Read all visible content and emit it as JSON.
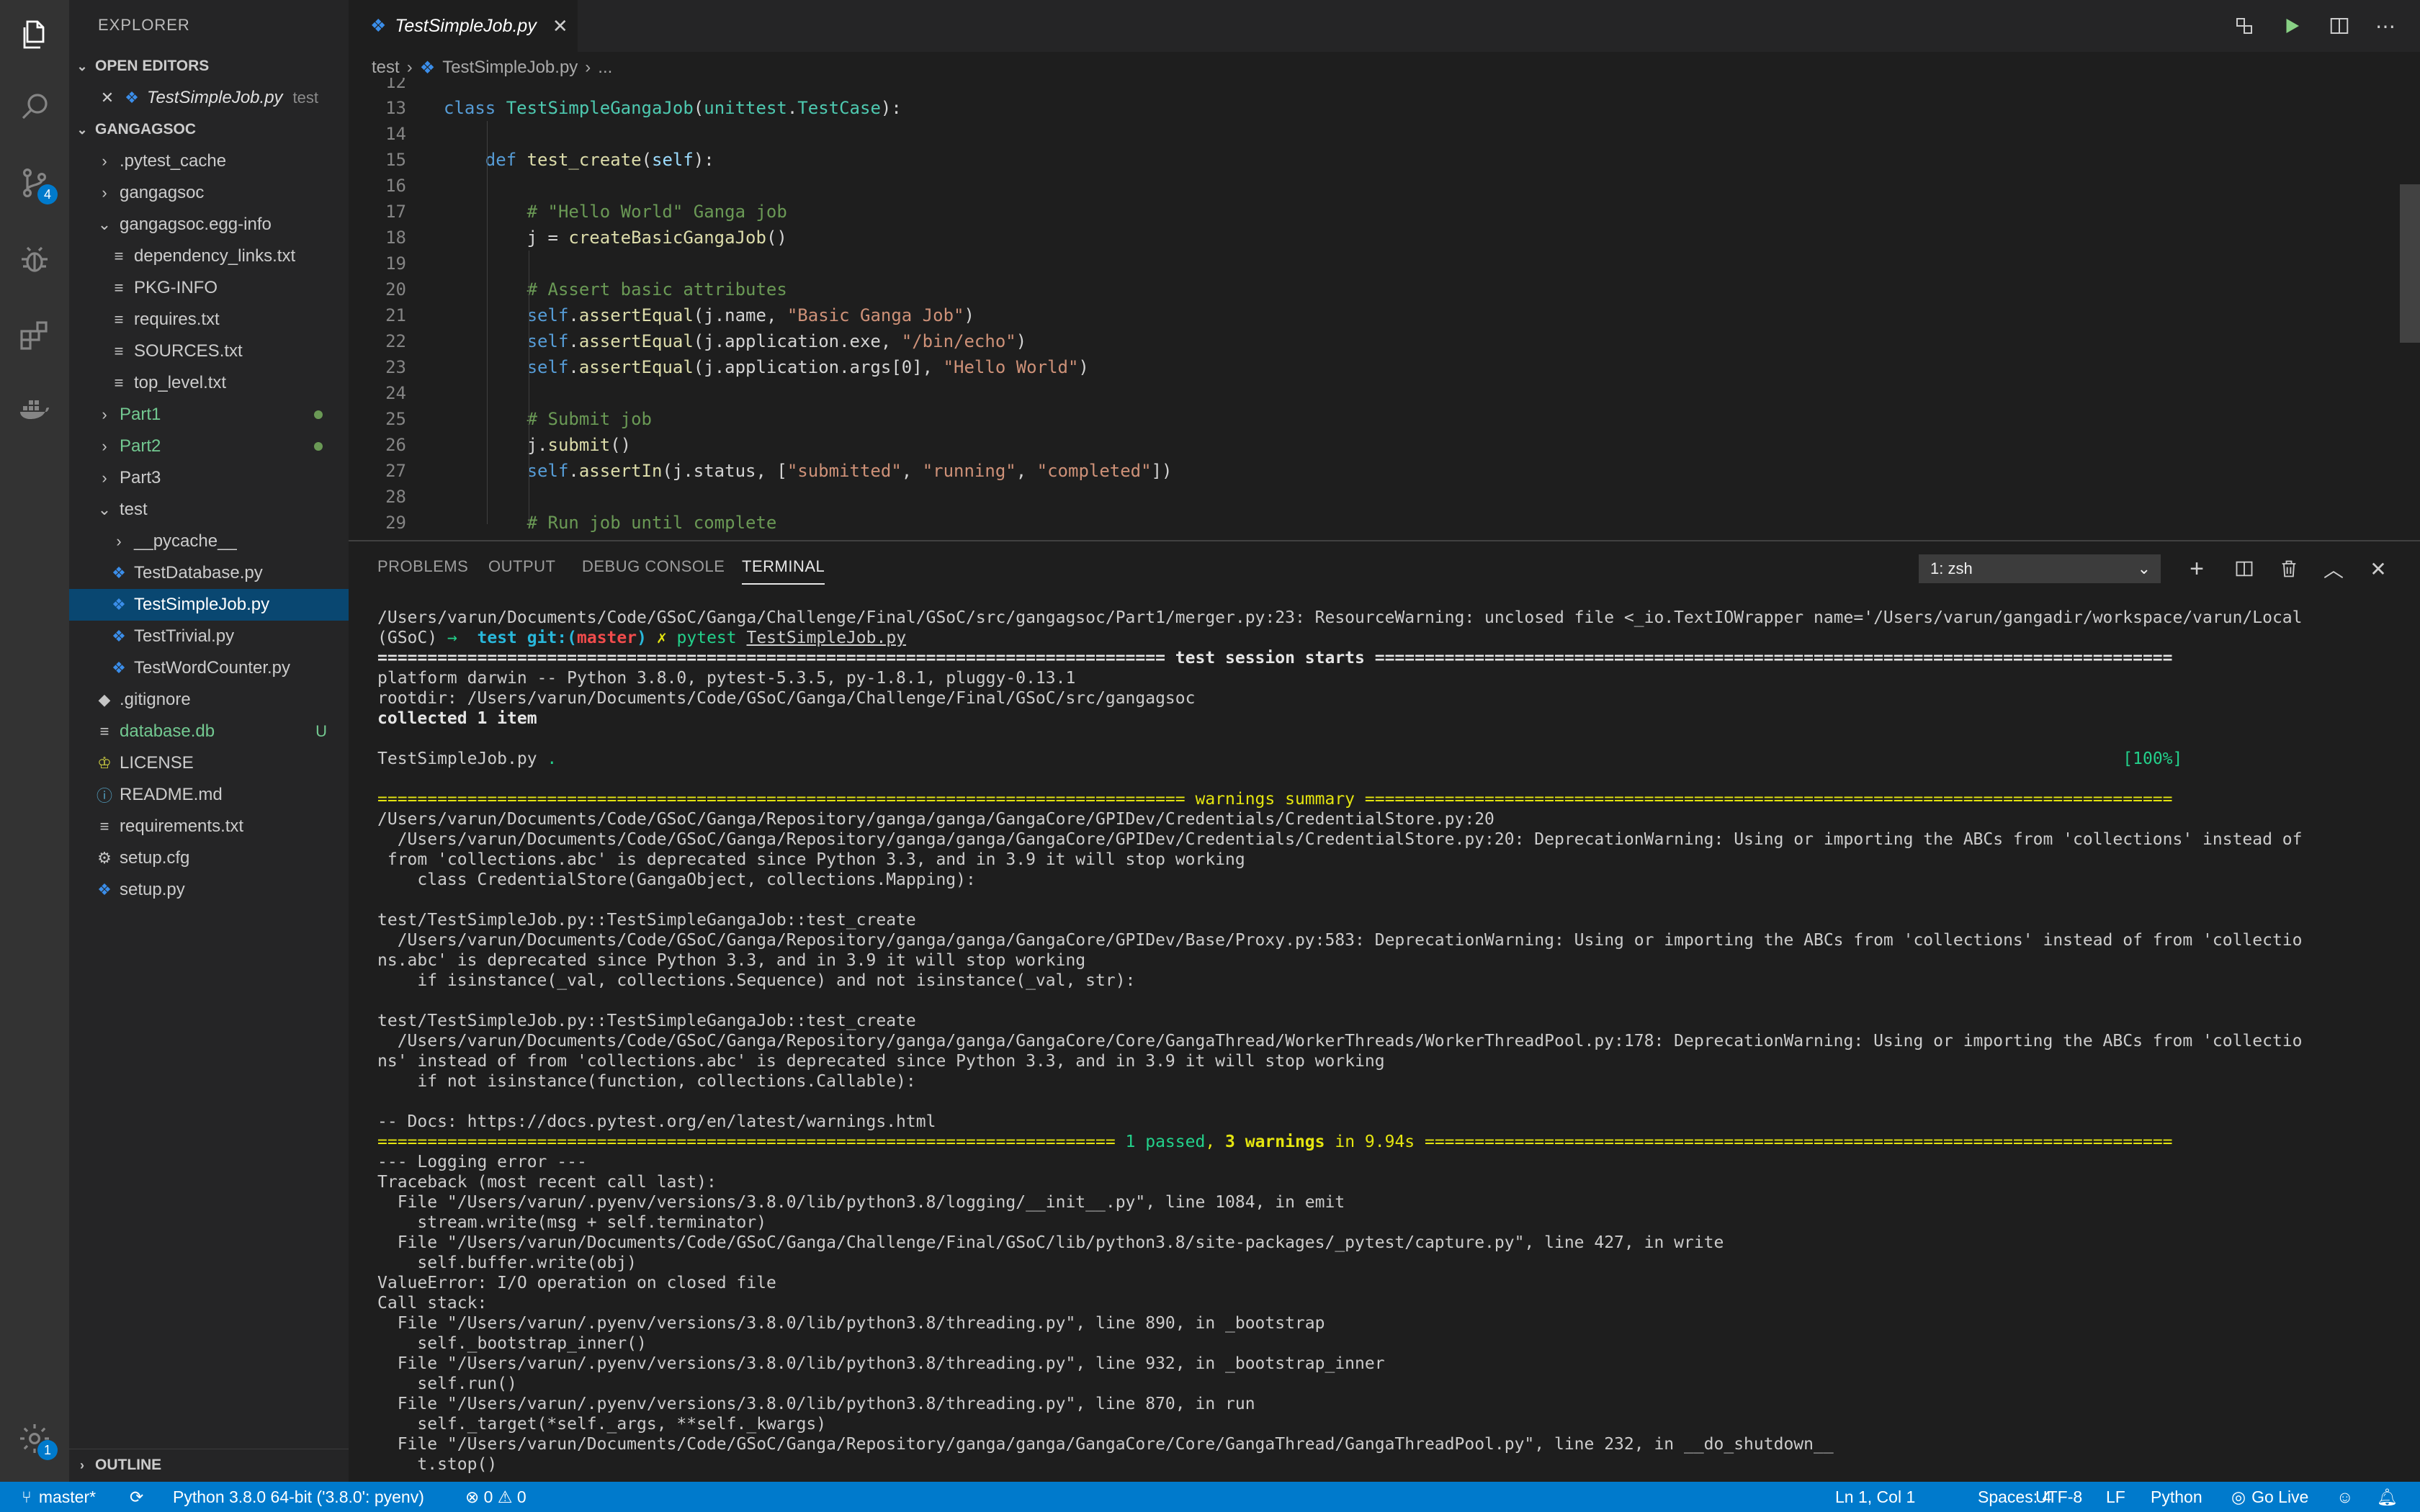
{
  "sidebar": {
    "title": "EXPLORER",
    "open_editors_label": "OPEN EDITORS",
    "open_editor": {
      "name": "TestSimpleJob.py",
      "folder": "test"
    },
    "project_label": "GANGAGSOC",
    "outline_label": "OUTLINE",
    "tree": [
      {
        "label": ".pytest_cache",
        "type": "folder-closed",
        "indent": 1,
        "color": "#cccccc"
      },
      {
        "label": "gangagsoc",
        "type": "folder-closed",
        "indent": 1,
        "color": "#cccccc"
      },
      {
        "label": "gangagsoc.egg-info",
        "type": "folder-open",
        "indent": 1,
        "color": "#cccccc"
      },
      {
        "label": "dependency_links.txt",
        "type": "file",
        "indent": 2,
        "color": "#cccccc"
      },
      {
        "label": "PKG-INFO",
        "type": "file",
        "indent": 2,
        "color": "#cccccc"
      },
      {
        "label": "requires.txt",
        "type": "file",
        "indent": 2,
        "color": "#cccccc"
      },
      {
        "label": "SOURCES.txt",
        "type": "file",
        "indent": 2,
        "color": "#cccccc"
      },
      {
        "label": "top_level.txt",
        "type": "file",
        "indent": 2,
        "color": "#cccccc"
      },
      {
        "label": "Part1",
        "type": "folder-closed",
        "indent": 1,
        "color": "#73c991",
        "dot": true
      },
      {
        "label": "Part2",
        "type": "folder-closed",
        "indent": 1,
        "color": "#73c991",
        "dot": true
      },
      {
        "label": "Part3",
        "type": "folder-closed",
        "indent": 1,
        "color": "#cccccc"
      },
      {
        "label": "test",
        "type": "folder-open",
        "indent": 1,
        "color": "#cccccc"
      },
      {
        "label": "__pycache__",
        "type": "folder-closed",
        "indent": 2,
        "color": "#cccccc"
      },
      {
        "label": "TestDatabase.py",
        "type": "py",
        "indent": 2,
        "color": "#cccccc"
      },
      {
        "label": "TestSimpleJob.py",
        "type": "py",
        "indent": 2,
        "color": "#ffffff",
        "selected": true
      },
      {
        "label": "TestTrivial.py",
        "type": "py",
        "indent": 2,
        "color": "#cccccc"
      },
      {
        "label": "TestWordCounter.py",
        "type": "py",
        "indent": 2,
        "color": "#cccccc"
      },
      {
        "label": ".gitignore",
        "type": "git",
        "indent": 1,
        "color": "#cccccc"
      },
      {
        "label": "database.db",
        "type": "file",
        "indent": 1,
        "color": "#73c991",
        "badge": "U"
      },
      {
        "label": "LICENSE",
        "type": "license",
        "indent": 1,
        "color": "#cccccc"
      },
      {
        "label": "README.md",
        "type": "info",
        "indent": 1,
        "color": "#cccccc"
      },
      {
        "label": "requirements.txt",
        "type": "file",
        "indent": 1,
        "color": "#cccccc"
      },
      {
        "label": "setup.cfg",
        "type": "gear",
        "indent": 1,
        "color": "#cccccc"
      },
      {
        "label": "setup.py",
        "type": "py",
        "indent": 1,
        "color": "#cccccc"
      }
    ]
  },
  "activity": {
    "scm_badge": "4",
    "settings_badge": "1"
  },
  "editor": {
    "tab": "TestSimpleJob.py",
    "breadcrumb": [
      "test",
      "TestSimpleJob.py",
      "..."
    ],
    "lines": [
      {
        "n": "12",
        "html": ""
      },
      {
        "n": "13",
        "html": "<span class='k'>class</span> <span class='c'>TestSimpleGangaJob</span>(<span class='c'>unittest</span>.<span class='c'>TestCase</span>):"
      },
      {
        "n": "14",
        "html": ""
      },
      {
        "n": "15",
        "html": "    <span class='k'>def</span> <span class='f'>test_create</span>(<span class='p'>self</span>):"
      },
      {
        "n": "16",
        "html": ""
      },
      {
        "n": "17",
        "html": "        <span class='cm'># \"Hello World\" Ganga job</span>"
      },
      {
        "n": "18",
        "html": "        j = <span class='f'>createBasicGangaJob</span>()"
      },
      {
        "n": "19",
        "html": ""
      },
      {
        "n": "20",
        "html": "        <span class='cm'># Assert basic attributes</span>"
      },
      {
        "n": "21",
        "html": "        <span class='k'>self</span>.<span class='f'>assertEqual</span>(j.name, <span class='s'>\"Basic Ganga Job\"</span>)"
      },
      {
        "n": "22",
        "html": "        <span class='k'>self</span>.<span class='f'>assertEqual</span>(j.application.exe, <span class='s'>\"/bin/echo\"</span>)"
      },
      {
        "n": "23",
        "html": "        <span class='k'>self</span>.<span class='f'>assertEqual</span>(j.application.args[0], <span class='s'>\"Hello World\"</span>)"
      },
      {
        "n": "24",
        "html": ""
      },
      {
        "n": "25",
        "html": "        <span class='cm'># Submit job</span>"
      },
      {
        "n": "26",
        "html": "        j.<span class='f'>submit</span>()"
      },
      {
        "n": "27",
        "html": "        <span class='k'>self</span>.<span class='f'>assertIn</span>(j.status, [<span class='s'>\"submitted\"</span>, <span class='s'>\"running\"</span>, <span class='s'>\"completed\"</span>])"
      },
      {
        "n": "28",
        "html": ""
      },
      {
        "n": "29",
        "html": "        <span class='cm'># Run job until complete</span>"
      }
    ]
  },
  "panel": {
    "tabs": [
      "PROBLEMS",
      "OUTPUT",
      "DEBUG CONSOLE",
      "TERMINAL"
    ],
    "active_tab": "TERMINAL",
    "terminal_select": "1: zsh",
    "terminal_lines": [
      "/Users/varun/Documents/Code/GSoC/Ganga/Challenge/Final/GSoC/src/gangagsoc/Part1/merger.py:23: ResourceWarning: unclosed file <_io.TextIOWrapper name='/Users/varun/gangadir/workspace/varun/Local",
      "(GSoC) <span class='g'>→</span>  <span class='cy bold'>test</span> <span class='cy bold'>git:(</span><span class='r bold'>master</span><span class='cy bold'>)</span> <span class='y'>✗</span> <span class='g'>pytest</span> <span class='u'>TestSimpleJob.py</span>",
      "<span class='bold'>=============================================================================== test session starts ================================================================================</span>",
      "platform darwin -- Python 3.8.0, pytest-5.3.5, py-1.8.1, pluggy-0.13.1",
      "rootdir: /Users/varun/Documents/Code/GSoC/Ganga/Challenge/Final/GSoC/src/gangagsoc",
      "<span class='bold'>collected 1 item</span>",
      "",
      "TestSimpleJob.py <span class='g'>.</span>                                                                                                                                                             <span class='g'>[100%]</span>",
      "",
      "<span class='y'>================================================================================= warnings summary =================================================================================</span>",
      "/Users/varun/Documents/Code/GSoC/Ganga/Repository/ganga/ganga/GangaCore/GPIDev/Credentials/CredentialStore.py:20",
      "  /Users/varun/Documents/Code/GSoC/Ganga/Repository/ganga/ganga/GangaCore/GPIDev/Credentials/CredentialStore.py:20: DeprecationWarning: Using or importing the ABCs from 'collections' instead of",
      " from 'collections.abc' is deprecated since Python 3.3, and in 3.9 it will stop working",
      "    class CredentialStore(GangaObject, collections.Mapping):",
      "",
      "test/TestSimpleJob.py::TestSimpleGangaJob::test_create",
      "  /Users/varun/Documents/Code/GSoC/Ganga/Repository/ganga/ganga/GangaCore/GPIDev/Base/Proxy.py:583: DeprecationWarning: Using or importing the ABCs from 'collections' instead of from 'collectio",
      "ns.abc' is deprecated since Python 3.3, and in 3.9 it will stop working",
      "    if isinstance(_val, collections.Sequence) and not isinstance(_val, str):",
      "",
      "test/TestSimpleJob.py::TestSimpleGangaJob::test_create",
      "  /Users/varun/Documents/Code/GSoC/Ganga/Repository/ganga/ganga/GangaCore/Core/GangaThread/WorkerThreads/WorkerThreadPool.py:178: DeprecationWarning: Using or importing the ABCs from 'collectio",
      "ns' instead of from 'collections.abc' is deprecated since Python 3.3, and in 3.9 it will stop working",
      "    if not isinstance(function, collections.Callable):",
      "",
      "-- Docs: https://docs.pytest.org/en/latest/warnings.html",
      "<span class='y'>========================================================================== </span><span class='g'>1 passed</span><span class='y'>, </span><span class='y bold'>3 warnings</span><span class='y'> in 9.94s ===========================================================================</span>",
      "--- Logging error ---",
      "Traceback (most recent call last):",
      "  File \"/Users/varun/.pyenv/versions/3.8.0/lib/python3.8/logging/__init__.py\", line 1084, in emit",
      "    stream.write(msg + self.terminator)",
      "  File \"/Users/varun/Documents/Code/GSoC/Ganga/Challenge/Final/GSoC/lib/python3.8/site-packages/_pytest/capture.py\", line 427, in write",
      "    self.buffer.write(obj)",
      "ValueError: I/O operation on closed file",
      "Call stack:",
      "  File \"/Users/varun/.pyenv/versions/3.8.0/lib/python3.8/threading.py\", line 890, in _bootstrap",
      "    self._bootstrap_inner()",
      "  File \"/Users/varun/.pyenv/versions/3.8.0/lib/python3.8/threading.py\", line 932, in _bootstrap_inner",
      "    self.run()",
      "  File \"/Users/varun/.pyenv/versions/3.8.0/lib/python3.8/threading.py\", line 870, in run",
      "    self._target(*self._args, **self._kwargs)",
      "  File \"/Users/varun/Documents/Code/GSoC/Ganga/Repository/ganga/ganga/GangaCore/Core/GangaThread/GangaThreadPool.py\", line 232, in __do_shutdown__",
      "    t.stop()"
    ]
  },
  "statusbar": {
    "branch": "master*",
    "python": "Python 3.8.0 64-bit ('3.8.0': pyenv)",
    "errors": "0",
    "warnings": "0",
    "cursor": "Ln 1, Col 1",
    "spaces": "Spaces: 4",
    "encoding": "UTF-8",
    "eol": "LF",
    "language": "Python",
    "golive": "Go Live"
  },
  "colors": {
    "accent": "#007acc",
    "selection": "#094771",
    "untracked": "#73c991"
  }
}
